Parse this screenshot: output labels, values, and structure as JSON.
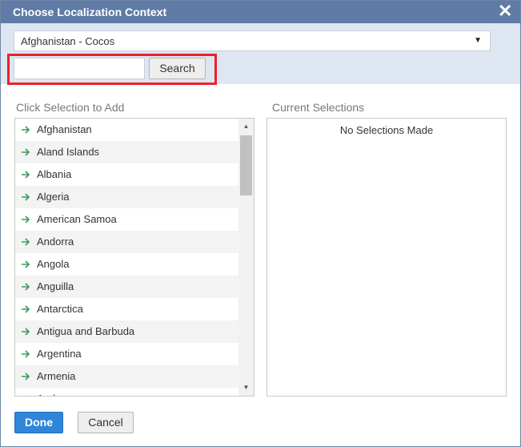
{
  "dialog": {
    "title": "Choose Localization Context",
    "close_glyph": "✕"
  },
  "range_select": {
    "value": "Afghanistan - Cocos",
    "arrow_glyph": "▼"
  },
  "search": {
    "input_value": "",
    "button_label": "Search"
  },
  "left_panel": {
    "label": "Click Selection to Add",
    "items": [
      "Afghanistan",
      "Aland Islands",
      "Albania",
      "Algeria",
      "American Samoa",
      "Andorra",
      "Angola",
      "Anguilla",
      "Antarctica",
      "Antigua and Barbuda",
      "Argentina",
      "Armenia",
      "Aruba"
    ]
  },
  "right_panel": {
    "label": "Current Selections",
    "empty_text": "No Selections Made"
  },
  "footer": {
    "done_label": "Done",
    "cancel_label": "Cancel"
  },
  "colors": {
    "title_bar": "#5f7ba6",
    "header_area": "#dde6f1",
    "highlight_border": "#e8222c",
    "arrow_icon": "#3a9a5b",
    "done_button": "#2f86d8"
  },
  "icons": {
    "item_icon": "arrow-right-icon",
    "close": "close-icon",
    "dropdown": "chevron-down-icon"
  }
}
